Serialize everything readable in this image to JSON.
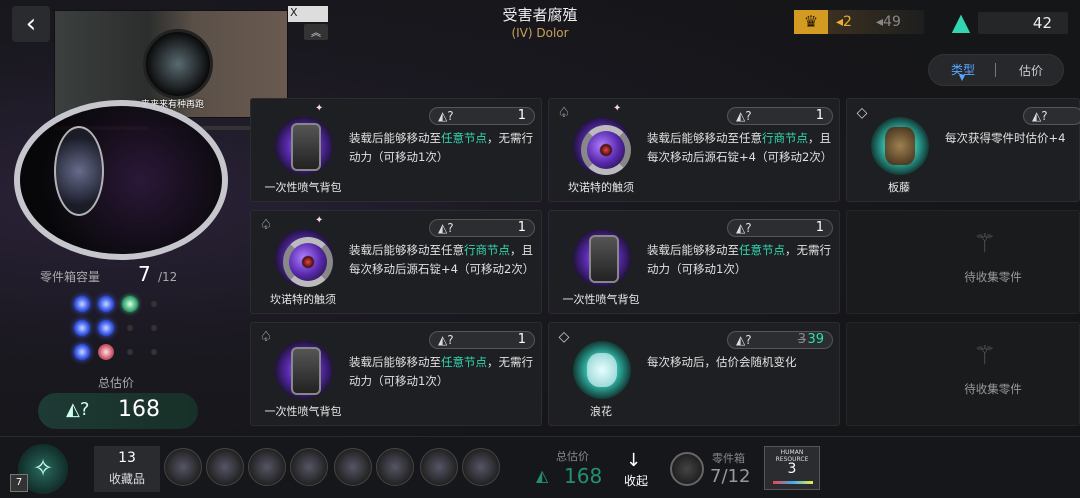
{
  "header": {
    "back_icon": "chevron-left-icon",
    "title": "受害者腐殖",
    "subtitle": "(IV) Dolor",
    "video_caption": "来来来有种再跑",
    "video_close": "X"
  },
  "resources": {
    "gold": {
      "icon": "crown-shield-icon",
      "a": "2",
      "b": "49",
      "color": "#d49b22"
    },
    "crystal": {
      "icon": "teal-triangle-icon",
      "value": "42",
      "color": "#33d6b0"
    }
  },
  "sorter": {
    "option_a": "类型",
    "option_b": "估价"
  },
  "left_panel": {
    "capacity_label": "零件箱容量",
    "capacity_value": "7",
    "capacity_max": "/12",
    "estimate_label": "总估价",
    "estimate_value": "168"
  },
  "cards": [
    {
      "name": "一次性喷气背包",
      "price": "1",
      "desc_pre": "装载后能够移动至",
      "desc_hl": "任意节点",
      "desc_post": "，无需行动力（可移动1次）"
    },
    {
      "name": "坎诺特的触须",
      "price": "1",
      "desc_pre": "装载后能够移动至任意",
      "desc_hl": "行商节点",
      "desc_post": "，且每次移动后源石锭+4（可移动2次）"
    },
    {
      "name": "板藤",
      "price": "",
      "desc_pre": "每次获得零件时估价+4",
      "desc_hl": "",
      "desc_post": ""
    },
    {
      "name": "坎诺特的触须",
      "price": "1",
      "desc_pre": "装载后能够移动至任意",
      "desc_hl": "行商节点",
      "desc_post": "，且每次移动后源石锭+4（可移动2次）"
    },
    {
      "name": "一次性喷气背包",
      "price": "1",
      "desc_pre": "装载后能够移动至",
      "desc_hl": "任意节点",
      "desc_post": "，无需行动力（可移动1次）"
    },
    {
      "empty_label": "待收集零件"
    },
    {
      "name": "一次性喷气背包",
      "price": "1",
      "desc_pre": "装载后能够移动至",
      "desc_hl": "任意节点",
      "desc_post": "，无需行动力（可移动1次）"
    },
    {
      "name": "浪花",
      "price_old": "3",
      "price_new": "39",
      "desc_pre": "每次移动后，估价会随机变化",
      "desc_hl": "",
      "desc_post": ""
    },
    {
      "empty_label": "待收集零件"
    }
  ],
  "bottom": {
    "level": "7",
    "collection_count": "13",
    "collection_label": "收藏品",
    "estimate_label": "总估价",
    "estimate_value": "168",
    "collapse_label": "收起",
    "capacity_label": "零件箱",
    "capacity_value": "7/12",
    "human_title": "HUMAN RESOURCE",
    "human_value": "3"
  }
}
